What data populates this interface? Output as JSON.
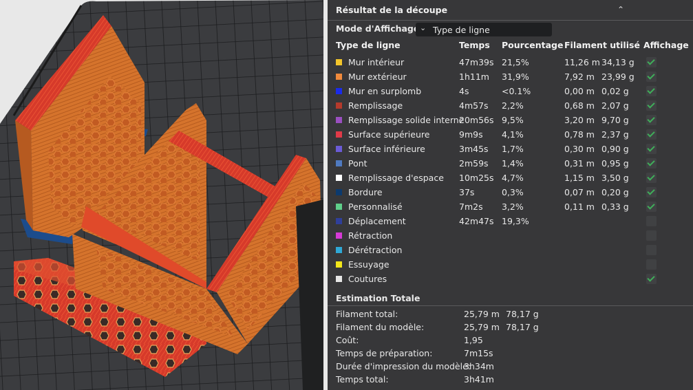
{
  "panel": {
    "title": "Résultat de la découpe",
    "mode_label": "Mode d'Affichage",
    "mode_value": "Type de ligne",
    "headers": {
      "type": "Type de ligne",
      "time": "Temps",
      "percent": "Pourcentage",
      "filament": "Filament utilisé",
      "display": "Affichage"
    },
    "rows": [
      {
        "name": "Mur intérieur",
        "color": "#f2c52b",
        "time": "47m39s",
        "percent": "21,5%",
        "length": "11,26 m",
        "weight": "34,13 g",
        "shown": true
      },
      {
        "name": "Mur extérieur",
        "color": "#f08a3c",
        "time": "1h11m",
        "percent": "31,9%",
        "length": "7,92 m",
        "weight": "23,99 g",
        "shown": true
      },
      {
        "name": "Mur en surplomb",
        "color": "#1a2bea",
        "time": "4s",
        "percent": "<0.1%",
        "length": "0,00 m",
        "weight": "0,02 g",
        "shown": true
      },
      {
        "name": "Remplissage",
        "color": "#b43a2c",
        "time": "4m57s",
        "percent": "2,2%",
        "length": "0,68 m",
        "weight": "2,07 g",
        "shown": true
      },
      {
        "name": "Remplissage solide interne",
        "color": "#9a4fc0",
        "time": "20m56s",
        "percent": "9,5%",
        "length": "3,20 m",
        "weight": "9,70 g",
        "shown": true
      },
      {
        "name": "Surface supérieure",
        "color": "#e03a48",
        "time": "9m9s",
        "percent": "4,1%",
        "length": "0,78 m",
        "weight": "2,37 g",
        "shown": true
      },
      {
        "name": "Surface inférieure",
        "color": "#6b5bd6",
        "time": "3m45s",
        "percent": "1,7%",
        "length": "0,30 m",
        "weight": "0,90 g",
        "shown": true
      },
      {
        "name": "Pont",
        "color": "#4f7ac0",
        "time": "2m59s",
        "percent": "1,4%",
        "length": "0,31 m",
        "weight": "0,95 g",
        "shown": true
      },
      {
        "name": "Remplissage d'espace",
        "color": "#ffffff",
        "time": "10m25s",
        "percent": "4,7%",
        "length": "1,15 m",
        "weight": "3,50 g",
        "shown": true
      },
      {
        "name": "Bordure",
        "color": "#0c3a6e",
        "time": "37s",
        "percent": "0,3%",
        "length": "0,07 m",
        "weight": "0,20 g",
        "shown": true
      },
      {
        "name": "Personnalisé",
        "color": "#5fcf8a",
        "time": "7m2s",
        "percent": "3,2%",
        "length": "0,11 m",
        "weight": "0,33 g",
        "shown": true
      },
      {
        "name": "Déplacement",
        "color": "#2f3f9a",
        "time": "42m47s",
        "percent": "19,3%",
        "length": "",
        "weight": "",
        "shown": false
      },
      {
        "name": "Rétraction",
        "color": "#d63ad6",
        "time": "",
        "percent": "",
        "length": "",
        "weight": "",
        "shown": false
      },
      {
        "name": "Dérétraction",
        "color": "#2fa8d6",
        "time": "",
        "percent": "",
        "length": "",
        "weight": "",
        "shown": false
      },
      {
        "name": "Essuyage",
        "color": "#f2e61a",
        "time": "",
        "percent": "",
        "length": "",
        "weight": "",
        "shown": false
      },
      {
        "name": "Coutures",
        "color": "#e6e6e6",
        "time": "",
        "percent": "",
        "length": "",
        "weight": "",
        "shown": true
      }
    ],
    "summary_title": "Estimation Totale",
    "summary": [
      {
        "label": "Filament total:",
        "v1": "25,79 m",
        "v2": "78,17 g"
      },
      {
        "label": "Filament du modèle:",
        "v1": "25,79 m",
        "v2": "78,17 g"
      },
      {
        "label": "Coût:",
        "v1": "1,95",
        "v2": ""
      },
      {
        "label": "Temps de préparation:",
        "v1": "7m15s",
        "v2": ""
      },
      {
        "label": "Durée d'impression du modèle:",
        "v1": "3h34m",
        "v2": ""
      },
      {
        "label": "Temps total:",
        "v1": "3h41m",
        "v2": ""
      }
    ]
  }
}
